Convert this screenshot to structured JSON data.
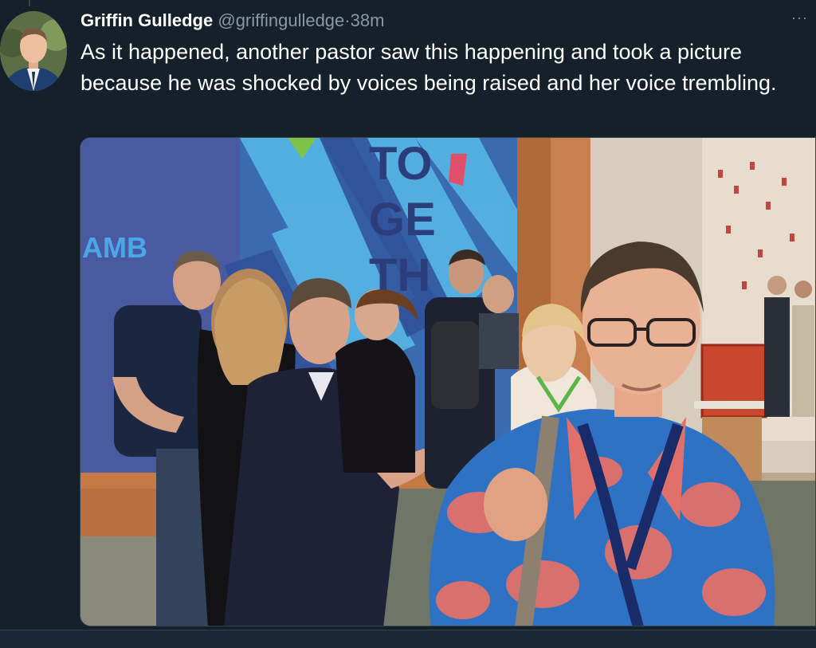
{
  "tweet": {
    "author_name": "Griffin Gulledge",
    "author_handle": "@griffingulledge",
    "separator": "·",
    "time": "38m",
    "more_label": "···",
    "text": "As it happened, another pastor saw this happening and took a picture because he was shocked by voices being raised and her voice trembling.",
    "media": {
      "banner_word": "AMB",
      "banner_letters": [
        "TO",
        "GE",
        "TH"
      ]
    }
  },
  "colors": {
    "background": "#15202b",
    "name": "#ffffff",
    "secondary_text": "#8899a6",
    "border": "#38444d"
  }
}
